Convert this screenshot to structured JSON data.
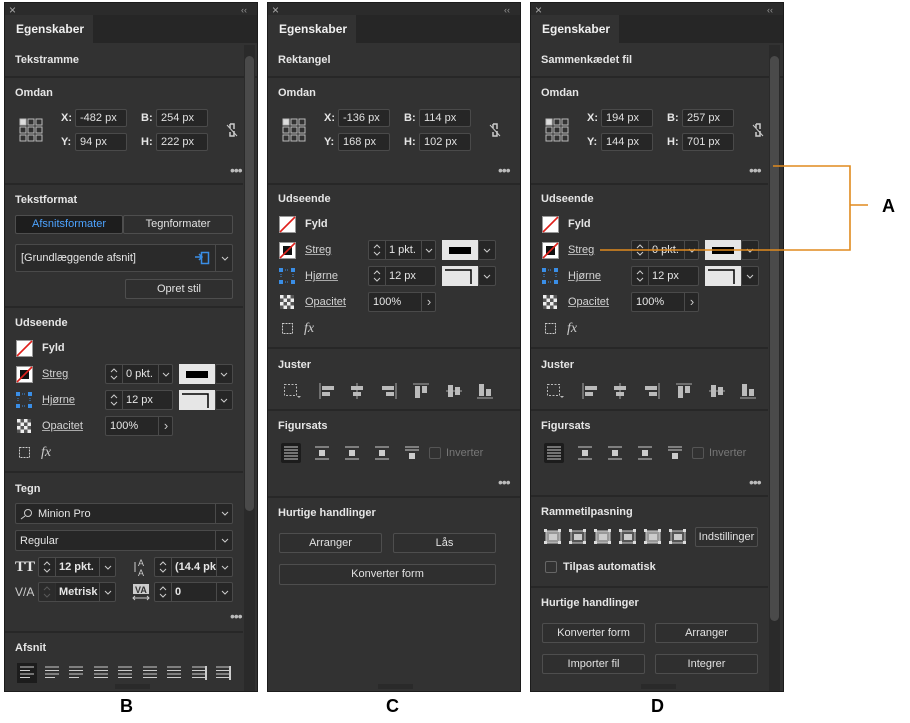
{
  "panels": {
    "b": {
      "label": "B",
      "close": "×",
      "collapse": "‹‹",
      "tab": "Egenskaber",
      "object_type": "Tekstramme",
      "transform": {
        "title": "Omdan",
        "x_label": "X:",
        "x": "-482 px",
        "y_label": "Y:",
        "y": "94 px",
        "w_label": "B:",
        "w": "254 px",
        "h_label": "H:",
        "h": "222 px"
      },
      "text_format": {
        "title": "Tekstformat",
        "tab1": "Afsnitsformater",
        "tab2": "Tegnformater",
        "active_tab": "Afsnitsformater",
        "style": "[Grundlæggende afsnit]",
        "create_style": "Opret stil"
      },
      "appearance": {
        "title": "Udseende",
        "fill": "Fyld",
        "stroke": "Streg",
        "stroke_weight": "0 pkt.",
        "corners": "Hjørne",
        "corner_size": "12 px",
        "opacity_label": "Opacitet",
        "opacity": "100%",
        "fx": "fx"
      },
      "character": {
        "title": "Tegn",
        "font": "Minion Pro",
        "style": "Regular",
        "size": "12 pkt.",
        "leading": "(14.4 pk",
        "kerning": "Metrisk",
        "tracking": "0"
      },
      "paragraph": {
        "title": "Afsnit"
      }
    },
    "c": {
      "label": "C",
      "close": "×",
      "collapse": "‹‹",
      "tab": "Egenskaber",
      "object_type": "Rektangel",
      "transform": {
        "title": "Omdan",
        "x_label": "X:",
        "x": "-136 px",
        "y_label": "Y:",
        "y": "168 px",
        "w_label": "B:",
        "w": "114 px",
        "h_label": "H:",
        "h": "102 px"
      },
      "appearance": {
        "title": "Udseende",
        "fill": "Fyld",
        "stroke": "Streg",
        "stroke_weight": "1 pkt.",
        "corners": "Hjørne",
        "corner_size": "12 px",
        "opacity_label": "Opacitet",
        "opacity": "100%",
        "fx": "fx"
      },
      "align": {
        "title": "Juster"
      },
      "text_wrap": {
        "title": "Figursats",
        "invert": "Inverter"
      },
      "quick_actions": {
        "title": "Hurtige handlinger",
        "buttons": [
          "Arranger",
          "Lås",
          "Konverter form"
        ]
      }
    },
    "d": {
      "label": "D",
      "close": "×",
      "collapse": "‹‹",
      "tab": "Egenskaber",
      "object_type": "Sammenkædet fil",
      "transform": {
        "title": "Omdan",
        "x_label": "X:",
        "x": "194 px",
        "y_label": "Y:",
        "y": "144 px",
        "w_label": "B:",
        "w": "257 px",
        "h_label": "H:",
        "h": "701 px"
      },
      "appearance": {
        "title": "Udseende",
        "fill": "Fyld",
        "stroke": "Streg",
        "stroke_weight": "0 pkt.",
        "corners": "Hjørne",
        "corner_size": "12 px",
        "opacity_label": "Opacitet",
        "opacity": "100%",
        "fx": "fx"
      },
      "align": {
        "title": "Juster"
      },
      "text_wrap": {
        "title": "Figursats",
        "invert": "Inverter"
      },
      "frame_fitting": {
        "title": "Rammetilpasning",
        "options": "Indstillinger",
        "auto_fit": "Tilpas automatisk"
      },
      "quick_actions": {
        "title": "Hurtige handlinger",
        "buttons": [
          "Konverter form",
          "Arranger",
          "Importer fil",
          "Integrer"
        ]
      }
    }
  },
  "callout": {
    "label": "A",
    "color": "#e08a1e"
  },
  "colors": {
    "accent": "#4da3ff",
    "panel_bg": "#323232"
  }
}
